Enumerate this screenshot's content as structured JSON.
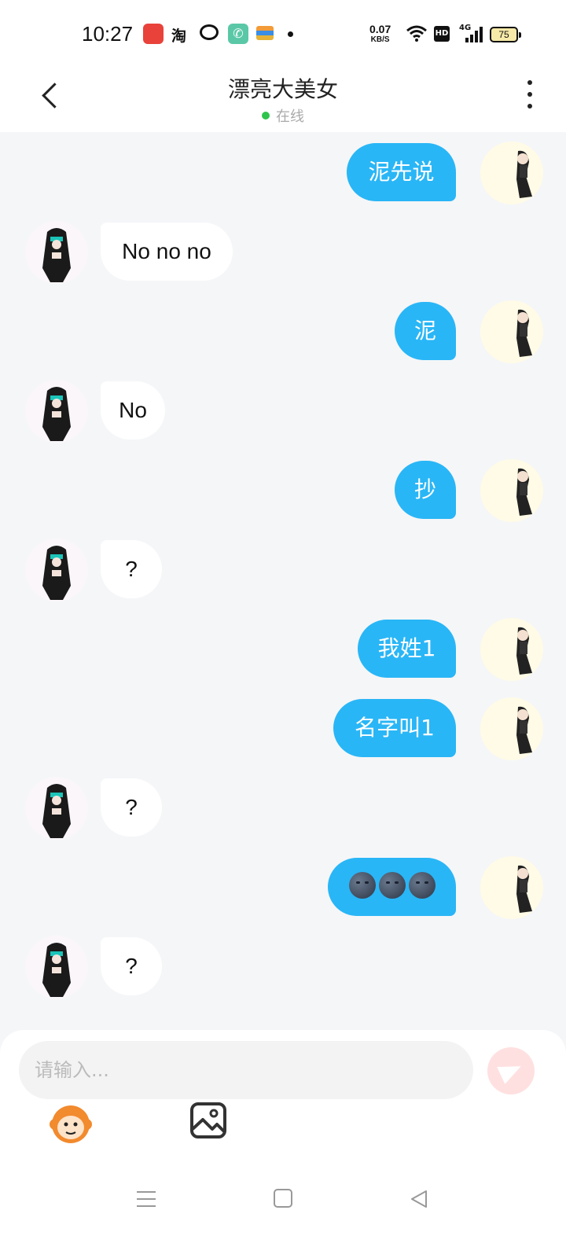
{
  "status_bar": {
    "time": "10:27",
    "taobao_label": "淘",
    "net_speed_value": "0.07",
    "net_speed_unit": "KB/S",
    "hd_label": "HD",
    "network_label": "4G",
    "battery_level": "75"
  },
  "header": {
    "title": "漂亮大美女",
    "status": "在线",
    "status_color": "#2ec44b"
  },
  "messages": [
    {
      "sender": "me",
      "text": "泥先说"
    },
    {
      "sender": "her",
      "text": "No no no"
    },
    {
      "sender": "me",
      "text": "泥"
    },
    {
      "sender": "her",
      "text": "No"
    },
    {
      "sender": "me",
      "text": "抄"
    },
    {
      "sender": "her",
      "text": "?"
    },
    {
      "sender": "me",
      "text": "我姓1"
    },
    {
      "sender": "me",
      "text": "名字叫1"
    },
    {
      "sender": "her",
      "text": "?"
    },
    {
      "sender": "me",
      "emoji": "new-moon-face",
      "emoji_count": 3
    },
    {
      "sender": "her",
      "text": "?"
    }
  ],
  "composer": {
    "placeholder": "请输入..."
  },
  "colors": {
    "my_bubble": "#29b6f6",
    "their_bubble": "#ffffff",
    "chat_background": "#f5f6f8",
    "send_button": "#ffe0e0"
  }
}
